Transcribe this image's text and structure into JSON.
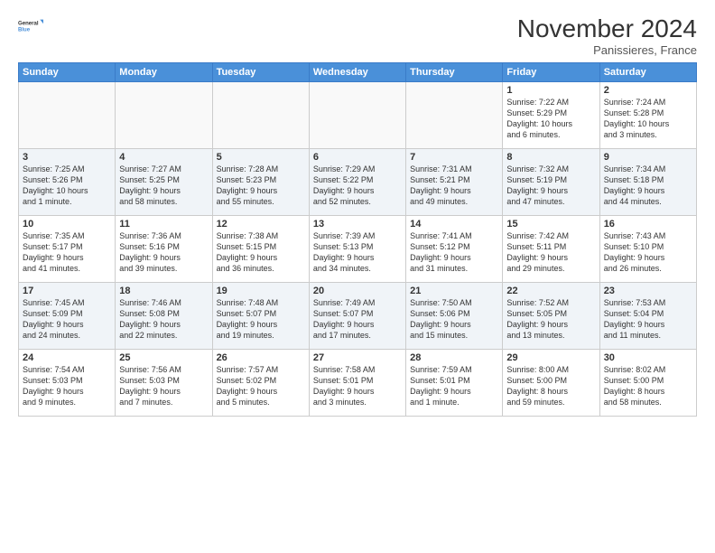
{
  "logo": {
    "line1": "General",
    "line2": "Blue"
  },
  "header": {
    "month_title": "November 2024",
    "location": "Panissieres, France"
  },
  "weekdays": [
    "Sunday",
    "Monday",
    "Tuesday",
    "Wednesday",
    "Thursday",
    "Friday",
    "Saturday"
  ],
  "weeks": [
    [
      {
        "day": "",
        "info": ""
      },
      {
        "day": "",
        "info": ""
      },
      {
        "day": "",
        "info": ""
      },
      {
        "day": "",
        "info": ""
      },
      {
        "day": "",
        "info": ""
      },
      {
        "day": "1",
        "info": "Sunrise: 7:22 AM\nSunset: 5:29 PM\nDaylight: 10 hours\nand 6 minutes."
      },
      {
        "day": "2",
        "info": "Sunrise: 7:24 AM\nSunset: 5:28 PM\nDaylight: 10 hours\nand 3 minutes."
      }
    ],
    [
      {
        "day": "3",
        "info": "Sunrise: 7:25 AM\nSunset: 5:26 PM\nDaylight: 10 hours\nand 1 minute."
      },
      {
        "day": "4",
        "info": "Sunrise: 7:27 AM\nSunset: 5:25 PM\nDaylight: 9 hours\nand 58 minutes."
      },
      {
        "day": "5",
        "info": "Sunrise: 7:28 AM\nSunset: 5:23 PM\nDaylight: 9 hours\nand 55 minutes."
      },
      {
        "day": "6",
        "info": "Sunrise: 7:29 AM\nSunset: 5:22 PM\nDaylight: 9 hours\nand 52 minutes."
      },
      {
        "day": "7",
        "info": "Sunrise: 7:31 AM\nSunset: 5:21 PM\nDaylight: 9 hours\nand 49 minutes."
      },
      {
        "day": "8",
        "info": "Sunrise: 7:32 AM\nSunset: 5:19 PM\nDaylight: 9 hours\nand 47 minutes."
      },
      {
        "day": "9",
        "info": "Sunrise: 7:34 AM\nSunset: 5:18 PM\nDaylight: 9 hours\nand 44 minutes."
      }
    ],
    [
      {
        "day": "10",
        "info": "Sunrise: 7:35 AM\nSunset: 5:17 PM\nDaylight: 9 hours\nand 41 minutes."
      },
      {
        "day": "11",
        "info": "Sunrise: 7:36 AM\nSunset: 5:16 PM\nDaylight: 9 hours\nand 39 minutes."
      },
      {
        "day": "12",
        "info": "Sunrise: 7:38 AM\nSunset: 5:15 PM\nDaylight: 9 hours\nand 36 minutes."
      },
      {
        "day": "13",
        "info": "Sunrise: 7:39 AM\nSunset: 5:13 PM\nDaylight: 9 hours\nand 34 minutes."
      },
      {
        "day": "14",
        "info": "Sunrise: 7:41 AM\nSunset: 5:12 PM\nDaylight: 9 hours\nand 31 minutes."
      },
      {
        "day": "15",
        "info": "Sunrise: 7:42 AM\nSunset: 5:11 PM\nDaylight: 9 hours\nand 29 minutes."
      },
      {
        "day": "16",
        "info": "Sunrise: 7:43 AM\nSunset: 5:10 PM\nDaylight: 9 hours\nand 26 minutes."
      }
    ],
    [
      {
        "day": "17",
        "info": "Sunrise: 7:45 AM\nSunset: 5:09 PM\nDaylight: 9 hours\nand 24 minutes."
      },
      {
        "day": "18",
        "info": "Sunrise: 7:46 AM\nSunset: 5:08 PM\nDaylight: 9 hours\nand 22 minutes."
      },
      {
        "day": "19",
        "info": "Sunrise: 7:48 AM\nSunset: 5:07 PM\nDaylight: 9 hours\nand 19 minutes."
      },
      {
        "day": "20",
        "info": "Sunrise: 7:49 AM\nSunset: 5:07 PM\nDaylight: 9 hours\nand 17 minutes."
      },
      {
        "day": "21",
        "info": "Sunrise: 7:50 AM\nSunset: 5:06 PM\nDaylight: 9 hours\nand 15 minutes."
      },
      {
        "day": "22",
        "info": "Sunrise: 7:52 AM\nSunset: 5:05 PM\nDaylight: 9 hours\nand 13 minutes."
      },
      {
        "day": "23",
        "info": "Sunrise: 7:53 AM\nSunset: 5:04 PM\nDaylight: 9 hours\nand 11 minutes."
      }
    ],
    [
      {
        "day": "24",
        "info": "Sunrise: 7:54 AM\nSunset: 5:03 PM\nDaylight: 9 hours\nand 9 minutes."
      },
      {
        "day": "25",
        "info": "Sunrise: 7:56 AM\nSunset: 5:03 PM\nDaylight: 9 hours\nand 7 minutes."
      },
      {
        "day": "26",
        "info": "Sunrise: 7:57 AM\nSunset: 5:02 PM\nDaylight: 9 hours\nand 5 minutes."
      },
      {
        "day": "27",
        "info": "Sunrise: 7:58 AM\nSunset: 5:01 PM\nDaylight: 9 hours\nand 3 minutes."
      },
      {
        "day": "28",
        "info": "Sunrise: 7:59 AM\nSunset: 5:01 PM\nDaylight: 9 hours\nand 1 minute."
      },
      {
        "day": "29",
        "info": "Sunrise: 8:00 AM\nSunset: 5:00 PM\nDaylight: 8 hours\nand 59 minutes."
      },
      {
        "day": "30",
        "info": "Sunrise: 8:02 AM\nSunset: 5:00 PM\nDaylight: 8 hours\nand 58 minutes."
      }
    ]
  ]
}
